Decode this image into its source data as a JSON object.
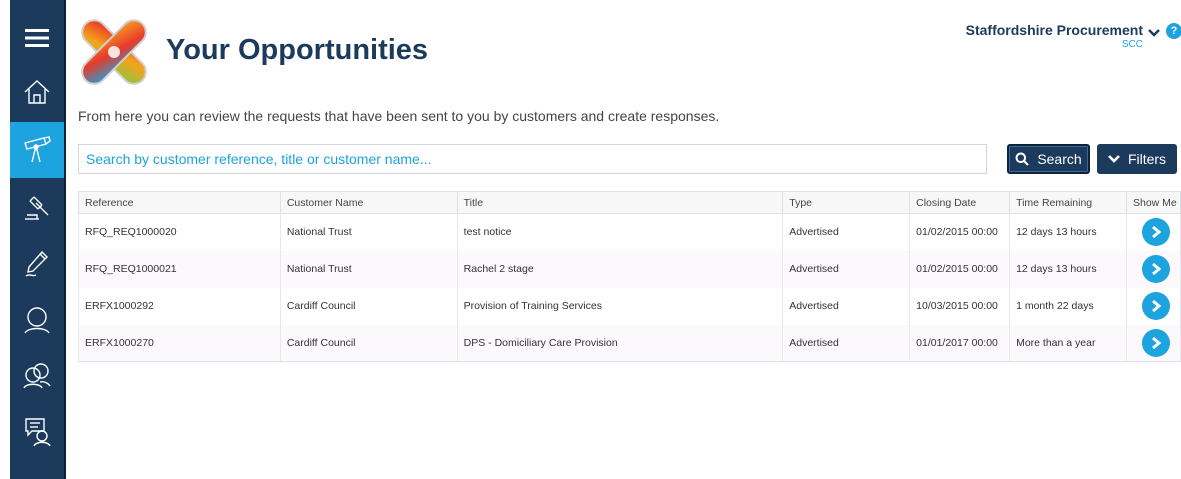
{
  "page": {
    "title": "Your Opportunities",
    "intro": "From here you can review the requests that have been sent to you by customers and create responses."
  },
  "org": {
    "name": "Staffordshire Procurement",
    "code": "SCC",
    "help": "?"
  },
  "search": {
    "placeholder": "Search by customer reference, title or customer name...",
    "search_label": "Search",
    "filters_label": "Filters"
  },
  "sidebar": {
    "items": [
      {
        "icon": "menu-icon"
      },
      {
        "icon": "home-icon"
      },
      {
        "icon": "telescope-icon",
        "active": true
      },
      {
        "icon": "gavel-icon"
      },
      {
        "icon": "pen-icon"
      },
      {
        "icon": "user-icon"
      },
      {
        "icon": "users-icon"
      },
      {
        "icon": "chat-user-icon"
      }
    ]
  },
  "table": {
    "headers": [
      "Reference",
      "Customer Name",
      "Title",
      "Type",
      "Closing Date",
      "Time Remaining",
      "Show Me"
    ],
    "rows": [
      {
        "reference": "RFQ_REQ1000020",
        "customer": "National Trust",
        "title": "test notice",
        "type": "Advertised",
        "closing": "01/02/2015 00:00",
        "remaining": "12 days 13 hours"
      },
      {
        "reference": "RFQ_REQ1000021",
        "customer": "National Trust",
        "title": "Rachel 2 stage",
        "type": "Advertised",
        "closing": "01/02/2015 00:00",
        "remaining": "12 days 13 hours"
      },
      {
        "reference": "ERFX1000292",
        "customer": "Cardiff Council",
        "title": "Provision of Training Services",
        "type": "Advertised",
        "closing": "10/03/2015 00:00",
        "remaining": "1 month 22 days"
      },
      {
        "reference": "ERFX1000270",
        "customer": "Cardiff Council",
        "title": "DPS - Domiciliary Care Provision",
        "type": "Advertised",
        "closing": "01/01/2017 00:00",
        "remaining": "More than a year"
      }
    ]
  },
  "colors": {
    "navy": "#1b3a5c",
    "accent": "#1da3dd"
  }
}
